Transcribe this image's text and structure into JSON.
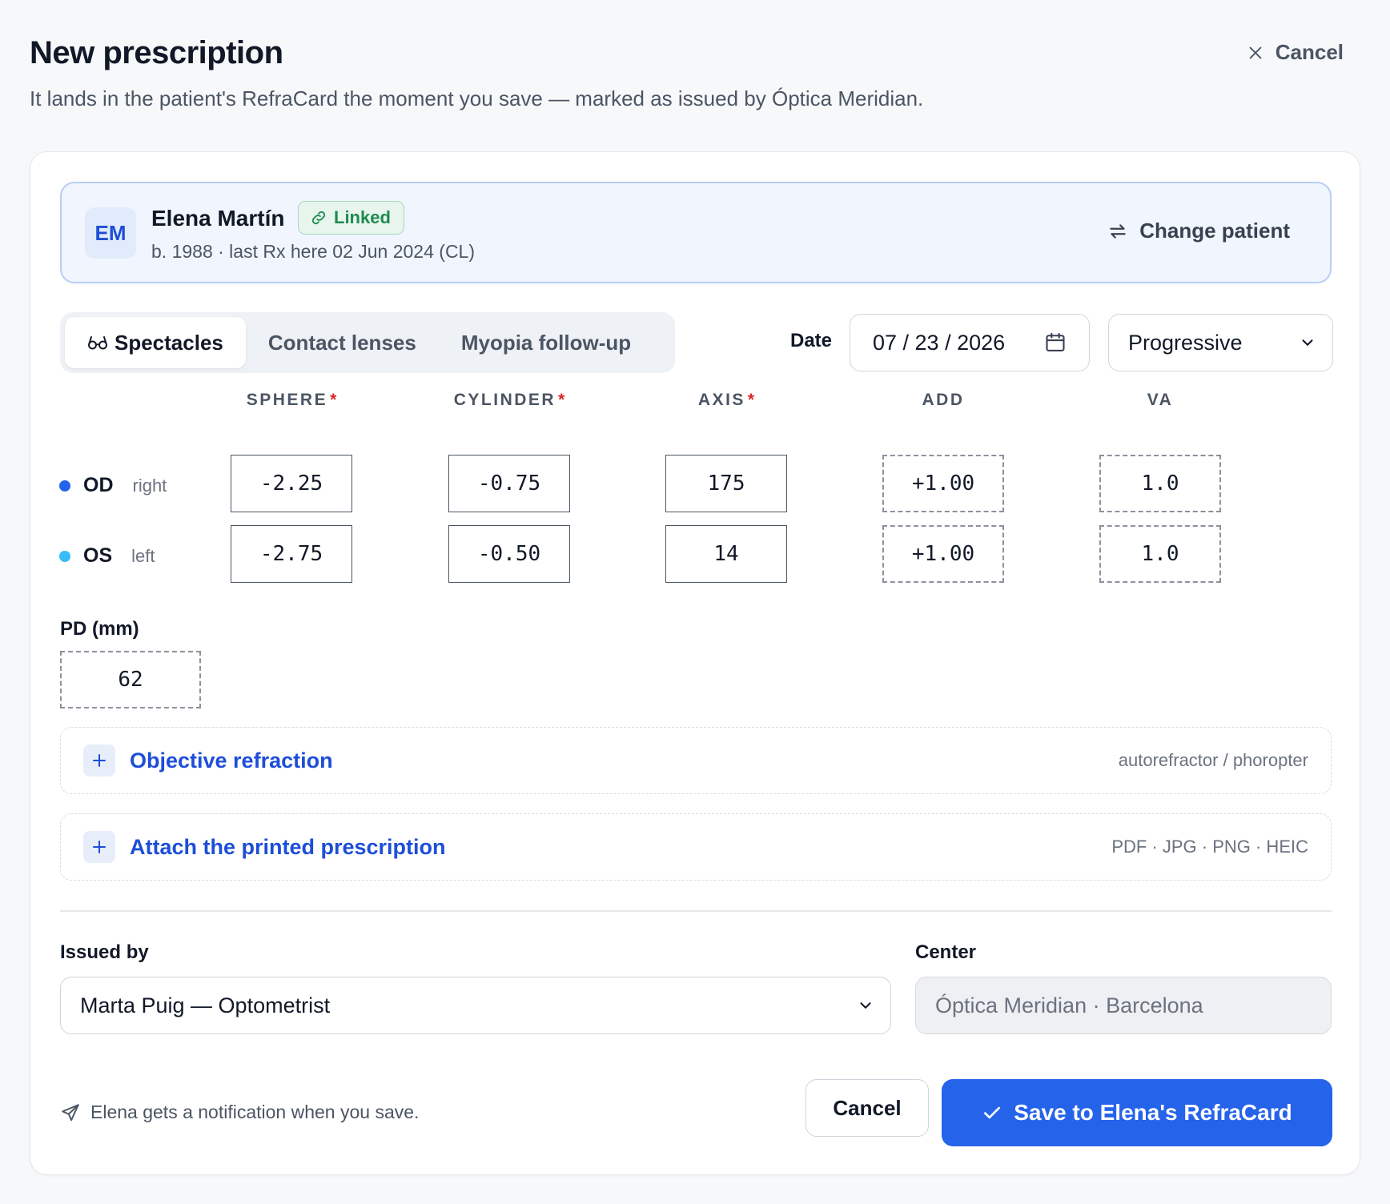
{
  "header": {
    "title": "New prescription",
    "subtitle": "It lands in the patient's RefraCard the moment you save — marked as issued by Óptica Meridian.",
    "cancel_label": "Cancel"
  },
  "patient": {
    "initials": "EM",
    "name": "Elena Martín",
    "badge": "Linked",
    "meta": "b. 1988 · last Rx here 02 Jun 2024 (CL)",
    "change_label": "Change patient"
  },
  "tabs": [
    {
      "label": "Spectacles",
      "active": true
    },
    {
      "label": "Contact lenses",
      "active": false
    },
    {
      "label": "Myopia follow-up",
      "active": false
    }
  ],
  "date": {
    "label": "Date",
    "value": "07 / 23 / 2026"
  },
  "lens_type": {
    "selected": "Progressive"
  },
  "rx": {
    "columns": [
      {
        "label": "SPHERE",
        "required": "*"
      },
      {
        "label": "CYLINDER",
        "required": "*"
      },
      {
        "label": "AXIS",
        "required": "*"
      },
      {
        "label": "ADD",
        "required": ""
      },
      {
        "label": "VA",
        "required": ""
      }
    ],
    "od": {
      "code": "OD",
      "side": "right",
      "color": "#2563eb",
      "sphere": "-2.25",
      "cylinder": "-0.75",
      "axis": "175",
      "add": "+1.00",
      "va": "1.0"
    },
    "os": {
      "code": "OS",
      "side": "left",
      "color": "#38bdf8",
      "sphere": "-2.75",
      "cylinder": "-0.50",
      "axis": "14",
      "add": "+1.00",
      "va": "1.0"
    }
  },
  "pd": {
    "label": "PD (mm)",
    "value": "62"
  },
  "sections": {
    "objective": {
      "title": "Objective refraction",
      "hint": "autorefractor / phoropter"
    },
    "attach": {
      "title": "Attach the printed prescription",
      "hint": "PDF · JPG · PNG · HEIC"
    }
  },
  "issued_by": {
    "label": "Issued by",
    "selected": "Marta Puig — Optometrist"
  },
  "center": {
    "label": "Center",
    "value": "Óptica Meridian · Barcelona"
  },
  "footer": {
    "notify_text": "Elena gets a notification when you save.",
    "cancel_label": "Cancel",
    "save_label": "Save to Elena's RefraCard"
  },
  "colors": {
    "accent": "#2563eb",
    "linked": "#1f8a4f",
    "required": "#dc2626"
  }
}
